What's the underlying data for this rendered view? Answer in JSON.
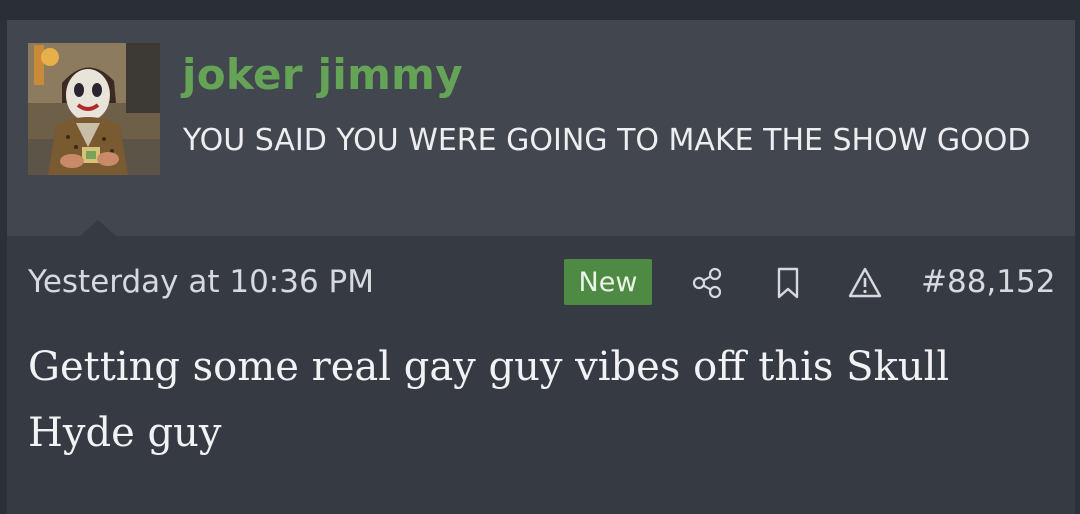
{
  "post": {
    "author": {
      "username": "joker jimmy",
      "user_title": "YOU SAID YOU WERE GOING TO MAKE THE SHOW GOOD",
      "avatar_icon": "avatar-image",
      "username_color": "#65a457"
    },
    "meta": {
      "timestamp": "Yesterday at 10:36 PM",
      "badge": "New",
      "badge_color": "#4f8a45",
      "actions": [
        "share-icon",
        "bookmark-icon",
        "report-icon"
      ],
      "post_number": "#88,152"
    },
    "body": "Getting some real gay guy vibes off this Skull Hyde guy"
  }
}
